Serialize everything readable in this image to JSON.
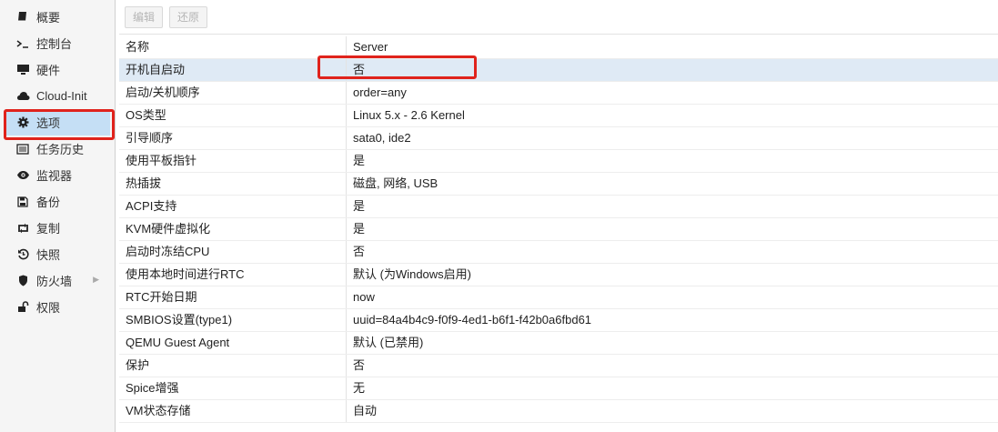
{
  "sidebar": {
    "items": [
      {
        "label": "概要",
        "icon": "book-icon"
      },
      {
        "label": "控制台",
        "icon": "terminal-icon"
      },
      {
        "label": "硬件",
        "icon": "monitor-icon"
      },
      {
        "label": "Cloud-Init",
        "icon": "cloud-icon"
      },
      {
        "label": "选项",
        "icon": "gear-icon",
        "selected": true
      },
      {
        "label": "任务历史",
        "icon": "list-icon"
      },
      {
        "label": "监视器",
        "icon": "eye-icon"
      },
      {
        "label": "备份",
        "icon": "floppy-icon"
      },
      {
        "label": "复制",
        "icon": "retweet-icon"
      },
      {
        "label": "快照",
        "icon": "history-icon"
      },
      {
        "label": "防火墙",
        "icon": "shield-icon",
        "has_submenu": true
      },
      {
        "label": "权限",
        "icon": "unlock-icon"
      }
    ]
  },
  "toolbar": {
    "edit_label": "编辑",
    "revert_label": "还原"
  },
  "options": [
    {
      "key": "名称",
      "value": "Server"
    },
    {
      "key": "开机自启动",
      "value": "否",
      "selected": true
    },
    {
      "key": "启动/关机顺序",
      "value": "order=any"
    },
    {
      "key": "OS类型",
      "value": "Linux 5.x - 2.6 Kernel"
    },
    {
      "key": "引导顺序",
      "value": "sata0, ide2"
    },
    {
      "key": "使用平板指针",
      "value": "是"
    },
    {
      "key": "热插拔",
      "value": "磁盘, 网络, USB"
    },
    {
      "key": "ACPI支持",
      "value": "是"
    },
    {
      "key": "KVM硬件虚拟化",
      "value": "是"
    },
    {
      "key": "启动时冻结CPU",
      "value": "否"
    },
    {
      "key": "使用本地时间进行RTC",
      "value": "默认 (为Windows启用)"
    },
    {
      "key": "RTC开始日期",
      "value": "now"
    },
    {
      "key": "SMBIOS设置(type1)",
      "value": "uuid=84a4b4c9-f0f9-4ed1-b6f1-f42b0a6fbd61"
    },
    {
      "key": "QEMU Guest Agent",
      "value": "默认 (已禁用)"
    },
    {
      "key": "保护",
      "value": "否"
    },
    {
      "key": "Spice增强",
      "value": "无"
    },
    {
      "key": "VM状态存储",
      "value": "自动"
    }
  ],
  "colors": {
    "highlight": "#e0231c",
    "selected_bg": "#c5dff5",
    "row_selected_bg": "#dfeaf5"
  }
}
